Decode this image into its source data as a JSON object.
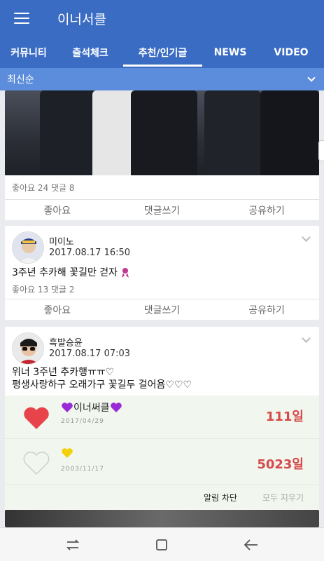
{
  "app": {
    "title": "이너서클"
  },
  "tabs": [
    {
      "label": "커뮤니티",
      "active": false
    },
    {
      "label": "출석체크",
      "active": false
    },
    {
      "label": "추천/인기글",
      "active": true
    },
    {
      "label": "NEWS",
      "active": false
    },
    {
      "label": "VIDEO",
      "active": false
    }
  ],
  "sort": {
    "label": "최신순"
  },
  "posts": [
    {
      "counts": "좋아요 24 댓글 8",
      "actions": {
        "like": "좋아요",
        "comment": "댓글쓰기",
        "share": "공유하기"
      }
    },
    {
      "author": "미이노",
      "time": "2017.08.17 16:50",
      "text": "3주년 추카해 꽃길만 걷자",
      "counts": "좋아요 13 댓글 2",
      "actions": {
        "like": "좋아요",
        "comment": "댓글쓰기",
        "share": "공유하기"
      }
    },
    {
      "author": "흑발승윤",
      "time": "2017.08.17 07:03",
      "text_line1": "위너 3주년 추카행ㅠㅠ♡",
      "text_line2": "평생사랑하구 오래가구 꽃길두 걸어욤♡♡♡",
      "embed": {
        "rows": [
          {
            "name": "이너써클",
            "date": "2017/04/29",
            "days": "111일"
          },
          {
            "name": "",
            "date": "2003/11/17",
            "days": "5023일"
          }
        ],
        "notify_block": "알림 차단",
        "clear_all": "모두 지우기"
      }
    }
  ],
  "colors": {
    "primary": "#3a6cc4",
    "secondary": "#5c8ddc",
    "days": "#d64a4a"
  }
}
